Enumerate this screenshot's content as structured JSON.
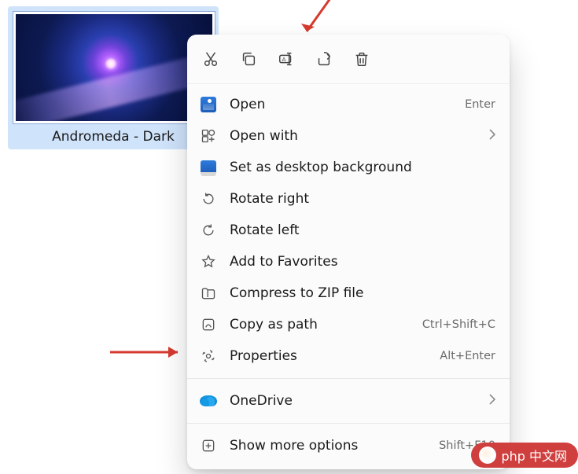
{
  "file": {
    "label": "Andromeda - Dark"
  },
  "toolbar": {
    "icons": [
      "cut",
      "copy",
      "rename",
      "share",
      "delete"
    ]
  },
  "menu": {
    "open": {
      "label": "Open",
      "shortcut": "Enter"
    },
    "open_with": {
      "label": "Open with"
    },
    "set_desktop": {
      "label": "Set as desktop background"
    },
    "rotate_right": {
      "label": "Rotate right"
    },
    "rotate_left": {
      "label": "Rotate left"
    },
    "add_favorites": {
      "label": "Add to Favorites"
    },
    "compress_zip": {
      "label": "Compress to ZIP file"
    },
    "copy_as_path": {
      "label": "Copy as path",
      "shortcut": "Ctrl+Shift+C"
    },
    "properties": {
      "label": "Properties",
      "shortcut": "Alt+Enter"
    },
    "onedrive": {
      "label": "OneDrive"
    },
    "show_more": {
      "label": "Show more options",
      "shortcut": "Shift+F10"
    }
  },
  "watermark": {
    "text": "php 中文网"
  },
  "colors": {
    "arrow": "#d63a2f",
    "selection": "#cfe3fb",
    "watermark": "#cf3f3e"
  }
}
